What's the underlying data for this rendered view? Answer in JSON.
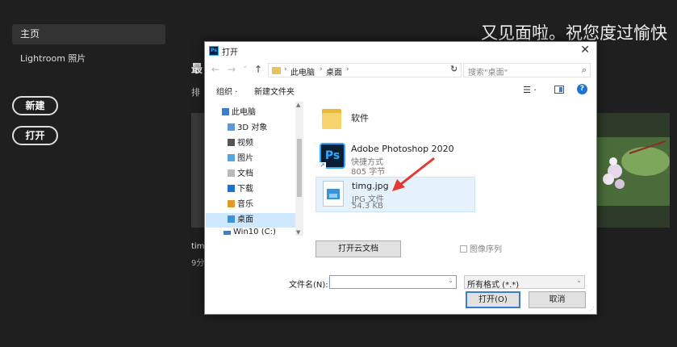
{
  "background": {
    "sidebar": {
      "home_label": "主页",
      "lightroom_label": "Lightroom 照片",
      "new_button": "新建",
      "open_button": "打开"
    },
    "greeting": "又见面啦。祝您度过愉快",
    "recent_title_partial": "最",
    "sort_label_partial": "排",
    "recent_file_name_partial": "tim",
    "recent_file_time_partial": "9分"
  },
  "dialog": {
    "title": "打开",
    "close_symbol": "✕",
    "nav": {
      "back": "←",
      "forward": "→",
      "recent": "⌄",
      "up": "↑",
      "breadcrumbs": [
        "此电脑",
        "桌面"
      ],
      "refresh": "↻",
      "search_placeholder": "搜索\"桌面\""
    },
    "toolbar": {
      "organize": "组织 ·",
      "new_folder": "新建文件夹"
    },
    "tree": [
      {
        "label": "此电脑",
        "color": "#3b7ccf"
      },
      {
        "label": "3D 对象",
        "color": "#5a9ad8"
      },
      {
        "label": "视频",
        "color": "#555"
      },
      {
        "label": "图片",
        "color": "#58a6e0"
      },
      {
        "label": "文档",
        "color": "#b9b9b9"
      },
      {
        "label": "下载",
        "color": "#1e73cf"
      },
      {
        "label": "音乐",
        "color": "#e09a2a"
      },
      {
        "label": "桌面",
        "color": "#3b92d8"
      },
      {
        "label": "Win10 (C:)",
        "color": "#4a7bc0"
      }
    ],
    "files": [
      {
        "name": "软件",
        "line1": "",
        "line2": "",
        "icon": "folder-icon"
      },
      {
        "name": "Adobe Photoshop 2020",
        "line1": "快捷方式",
        "line2": "805 字节",
        "icon": "photoshop-icon"
      },
      {
        "name": "timg.jpg",
        "line1": "JPG 文件",
        "line2": "54.3 KB",
        "icon": "image-file-icon"
      }
    ],
    "cloud_button": "打开云文档",
    "image_sequence": "图像序列",
    "filename_label": "文件名(N):",
    "filename_value": "",
    "filter_value": "所有格式 (*.*)",
    "open_button": "打开(O)",
    "cancel_button": "取消"
  },
  "colors": {
    "accent": "#3b7ccf",
    "selection": "#cde8ff",
    "annotation_arrow": "#e53935"
  }
}
